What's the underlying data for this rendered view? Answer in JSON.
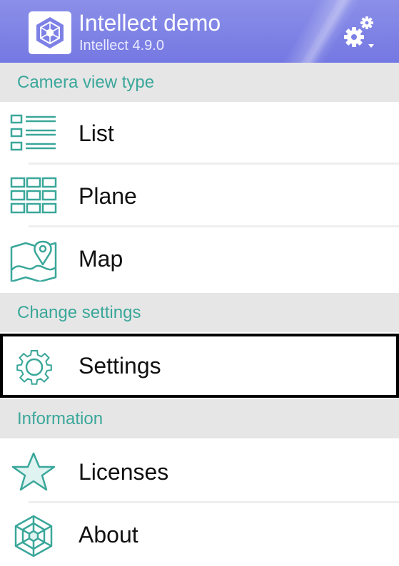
{
  "header": {
    "title": "Intellect demo",
    "subtitle": "Intellect 4.9.0",
    "logo_icon": "intellect-logo-icon",
    "settings_icon": "gears-icon",
    "color": "#7d81e5"
  },
  "sections": {
    "view_type": "Camera view type",
    "change_settings": "Change settings",
    "information": "Information"
  },
  "menu": {
    "list": "List",
    "plane": "Plane",
    "map": "Map",
    "settings": "Settings",
    "licenses": "Licenses",
    "about": "About"
  },
  "selected_item": "settings",
  "accent_color": "#3aa79a"
}
